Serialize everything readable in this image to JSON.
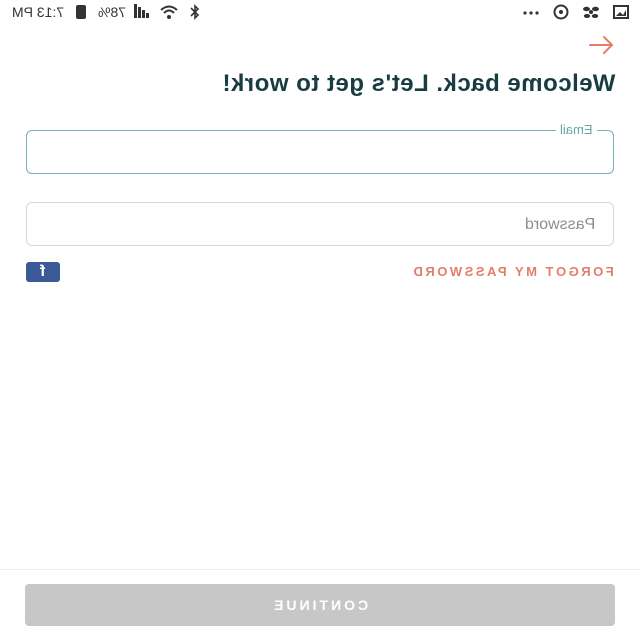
{
  "status_bar": {
    "time": "7:13 PM",
    "battery": "78%",
    "right_icons": [
      "more-icon",
      "headset-icon",
      "fan-icon",
      "image-icon"
    ],
    "left_icons": [
      "bluetooth-icon",
      "wifi-icon",
      "signal-icon",
      "battery-icon"
    ]
  },
  "header": {
    "title": "Welcome back. Let's get to work!",
    "nav_icon": "arrow-right-icon",
    "accent_color": "#e27d6b"
  },
  "form": {
    "email": {
      "label": "Email",
      "value": ""
    },
    "password": {
      "placeholder": "Password",
      "value": ""
    },
    "facebook_glyph": "f",
    "forgot_label": "FORGOT MY PASSWORD"
  },
  "footer": {
    "continue_label": "CONTINUE",
    "button_color": "#c7c7c7"
  }
}
